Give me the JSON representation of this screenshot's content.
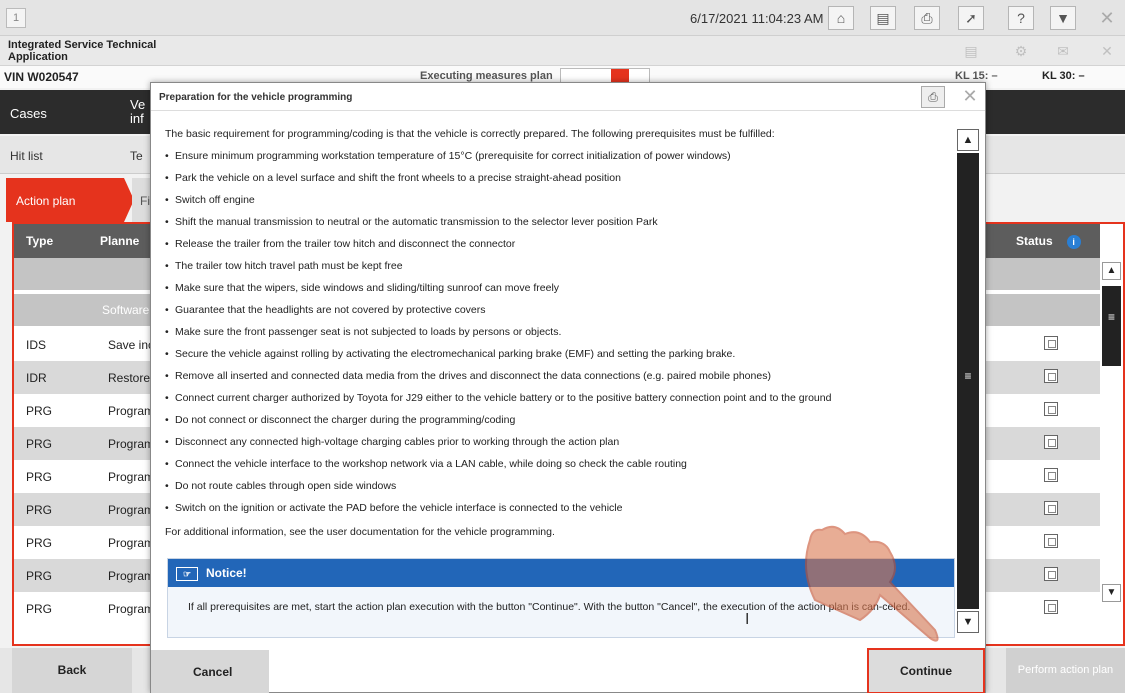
{
  "topbar": {
    "window_number": "1",
    "datetime": "6/17/2021 11:04:23 AM",
    "icons": [
      "home-icon",
      "card-icon",
      "printer-icon",
      "wrench-icon",
      "help-icon",
      "minimize-icon",
      "close-icon"
    ],
    "help_label": "?"
  },
  "appbar": {
    "title": "Integrated Service Technical Application"
  },
  "vinbar": {
    "vin": "VIN W020547",
    "executing_label": "Executing measures plan",
    "kl15": "KL 15: –",
    "kl30": "KL 30: –"
  },
  "nav": {
    "cases": "Cases",
    "vehicle_info": "Ve inf",
    "hit_list": "Hit list",
    "te": "Te",
    "action_plan": "Action plan",
    "fi": "Fi"
  },
  "table": {
    "headers": {
      "type": "Type",
      "planned": "Planne",
      "status": "Status"
    },
    "group_label": "Software",
    "rows": [
      {
        "type": "IDS",
        "plan": "Save inc"
      },
      {
        "type": "IDR",
        "plan": "Restore"
      },
      {
        "type": "PRG",
        "plan": "Program"
      },
      {
        "type": "PRG",
        "plan": "Program"
      },
      {
        "type": "PRG",
        "plan": "Program"
      },
      {
        "type": "PRG",
        "plan": "Program"
      },
      {
        "type": "PRG",
        "plan": "Program"
      },
      {
        "type": "PRG",
        "plan": "Program"
      },
      {
        "type": "PRG",
        "plan": "Program"
      }
    ]
  },
  "bottombar": {
    "back": "Back",
    "perform": "Perform action plan"
  },
  "modal": {
    "title": "Preparation for the vehicle programming",
    "intro": "The basic requirement for programming/coding is that the vehicle is correctly prepared. The following prerequisites must be fulfilled:",
    "bullets": [
      "Ensure minimum programming workstation temperature of 15°C (prerequisite for correct initialization of power windows)",
      "Park the vehicle on a level surface and shift the front wheels to a precise straight-ahead position",
      "Switch off engine",
      "Shift the manual transmission to neutral or the automatic transmission to the selector lever position Park",
      "Release the trailer from the trailer tow hitch and disconnect the connector",
      "The trailer tow hitch travel path must be kept free",
      "Make sure that the wipers, side windows and sliding/tilting sunroof can move freely",
      "Guarantee that the headlights are not covered by protective covers",
      "Make sure the front passenger seat is not subjected to loads by persons or objects.",
      "Secure the vehicle against rolling by activating the electromechanical parking brake (EMF) and setting the parking brake.",
      "Remove all inserted and connected data media from the drives and disconnect the data connections (e.g. paired mobile phones)",
      "Connect current charger authorized by Toyota for J29 either to the vehicle battery or to the positive battery connection point and to the ground",
      "Do not connect or disconnect the charger during the programming/coding",
      "Disconnect any connected high-voltage charging cables prior to working through the action plan",
      "Connect the vehicle interface to the workshop network via a LAN cable, while doing so check the cable routing",
      "Do not route cables through open side windows",
      "Switch on the ignition or activate the PAD before the vehicle interface is connected to the vehicle"
    ],
    "outro": "For additional information, see the user documentation for the vehicle programming.",
    "notice_title": "Notice!",
    "notice_body": "If all prerequisites are met, start the action plan execution with the button \"Continue\". With the button \"Cancel\", the execution of the action plan is can-celed.",
    "cancel": "Cancel",
    "continue": "Continue"
  },
  "colors": {
    "accent_red": "#e5331d",
    "notice_blue": "#2266b8",
    "dark_nav": "#2c2c2c"
  }
}
